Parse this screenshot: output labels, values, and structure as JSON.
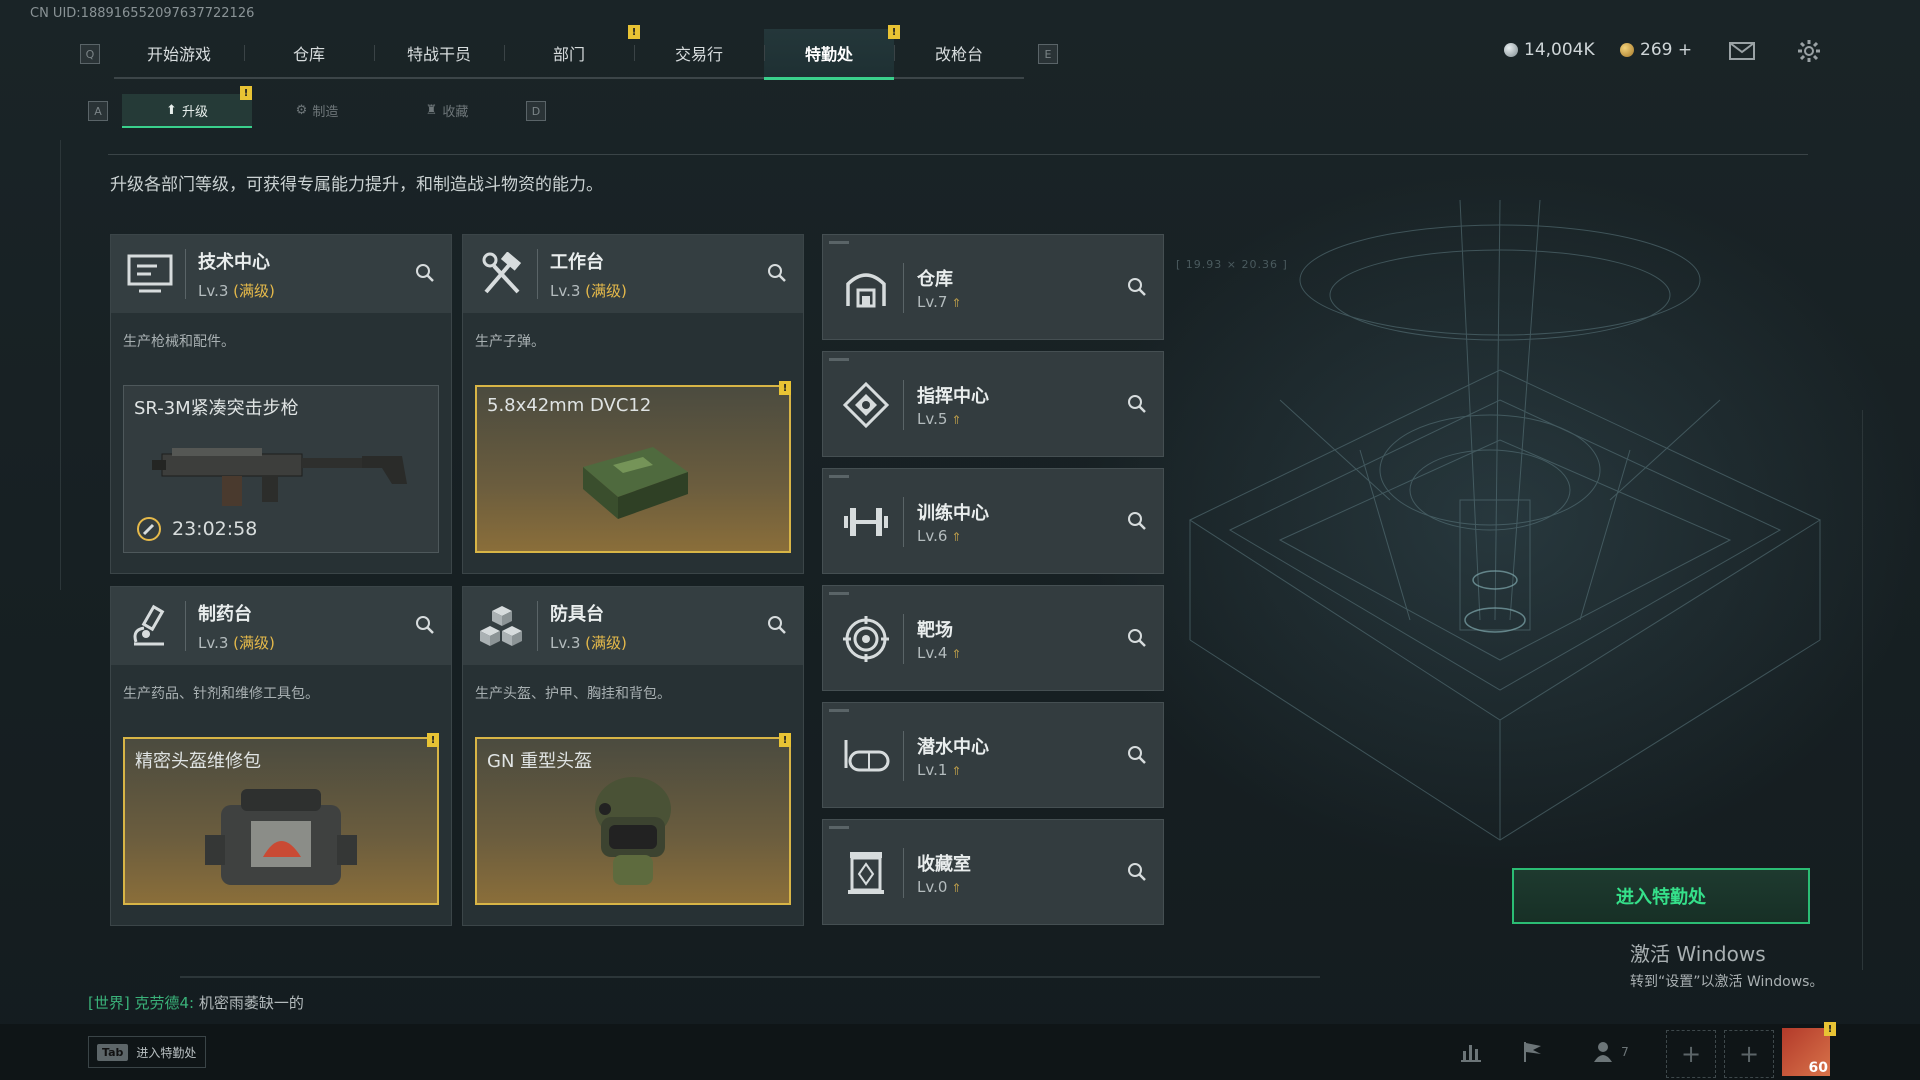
{
  "uid": "CN UID:1889165520976377221​26",
  "top_nav": {
    "left_key": "Q",
    "right_key": "E",
    "tabs": [
      {
        "label": "开始游戏",
        "badge": false
      },
      {
        "label": "仓库",
        "badge": false
      },
      {
        "label": "特战干员",
        "badge": false
      },
      {
        "label": "部门",
        "badge": true
      },
      {
        "label": "交易行",
        "badge": false
      },
      {
        "label": "特勤处",
        "badge": true,
        "active": true
      },
      {
        "label": "改枪台",
        "badge": false
      }
    ],
    "badge_text": "!"
  },
  "currency": {
    "coins": "14,004K",
    "premium": "269 +"
  },
  "sub_nav": {
    "left_key": "A",
    "right_key": "D",
    "tabs": [
      {
        "label": "升级",
        "active": true,
        "badge": true
      },
      {
        "label": "制造",
        "active": false
      },
      {
        "label": "收藏",
        "active": false
      }
    ]
  },
  "intro": "升级各部门等级，可获得专属能力提升，和制造战斗物资的能力。",
  "workshops": [
    {
      "title": "技术中心",
      "level": "Lv.3",
      "max": "(满级)",
      "desc": "生产枪械和配件。",
      "item": "SR-3M紧凑突击步枪",
      "item_style": "gray",
      "timer": "23:02:58",
      "icon": "monitor-icon"
    },
    {
      "title": "工作台",
      "level": "Lv.3",
      "max": "(满级)",
      "desc": "生产子弹。",
      "item": "5.8x42mm DVC12",
      "item_style": "gold",
      "icon": "hammer-wrench-icon"
    },
    {
      "title": "制药台",
      "level": "Lv.3",
      "max": "(满级)",
      "desc": "生产药品、针剂和维修工具包。",
      "item": "精密头盔维修包",
      "item_style": "gold",
      "icon": "microscope-icon"
    },
    {
      "title": "防具台",
      "level": "Lv.3",
      "max": "(满级)",
      "desc": "生产头盔、护甲、胸挂和背包。",
      "item": "GN 重型头盔",
      "item_style": "gold",
      "icon": "cubes-icon"
    }
  ],
  "departments": [
    {
      "title": "仓库",
      "level": "Lv.7",
      "icon": "warehouse-icon"
    },
    {
      "title": "指挥中心",
      "level": "Lv.5",
      "icon": "command-icon"
    },
    {
      "title": "训练中心",
      "level": "Lv.6",
      "icon": "dumbbell-icon"
    },
    {
      "title": "靶场",
      "level": "Lv.4",
      "icon": "target-icon"
    },
    {
      "title": "潜水中心",
      "level": "Lv.1",
      "icon": "diving-mask-icon"
    },
    {
      "title": "收藏室",
      "level": "Lv.0",
      "icon": "collection-icon"
    }
  ],
  "enter_button": "进入特勤处",
  "activate_windows": {
    "title": "激活 Windows",
    "subtitle": "转到“设置”以激活 Windows。"
  },
  "chat": {
    "channel": "[世界]",
    "name": "克劳德4:",
    "message": "机密雨萎缺一的"
  },
  "tab_hint": {
    "key": "Tab",
    "label": "进入特勤处"
  },
  "friends_count": "7",
  "player_level": "60",
  "colors": {
    "accent_green": "#3ad08c",
    "badge_yellow": "#e8c334",
    "max_level": "#e5b94a"
  }
}
